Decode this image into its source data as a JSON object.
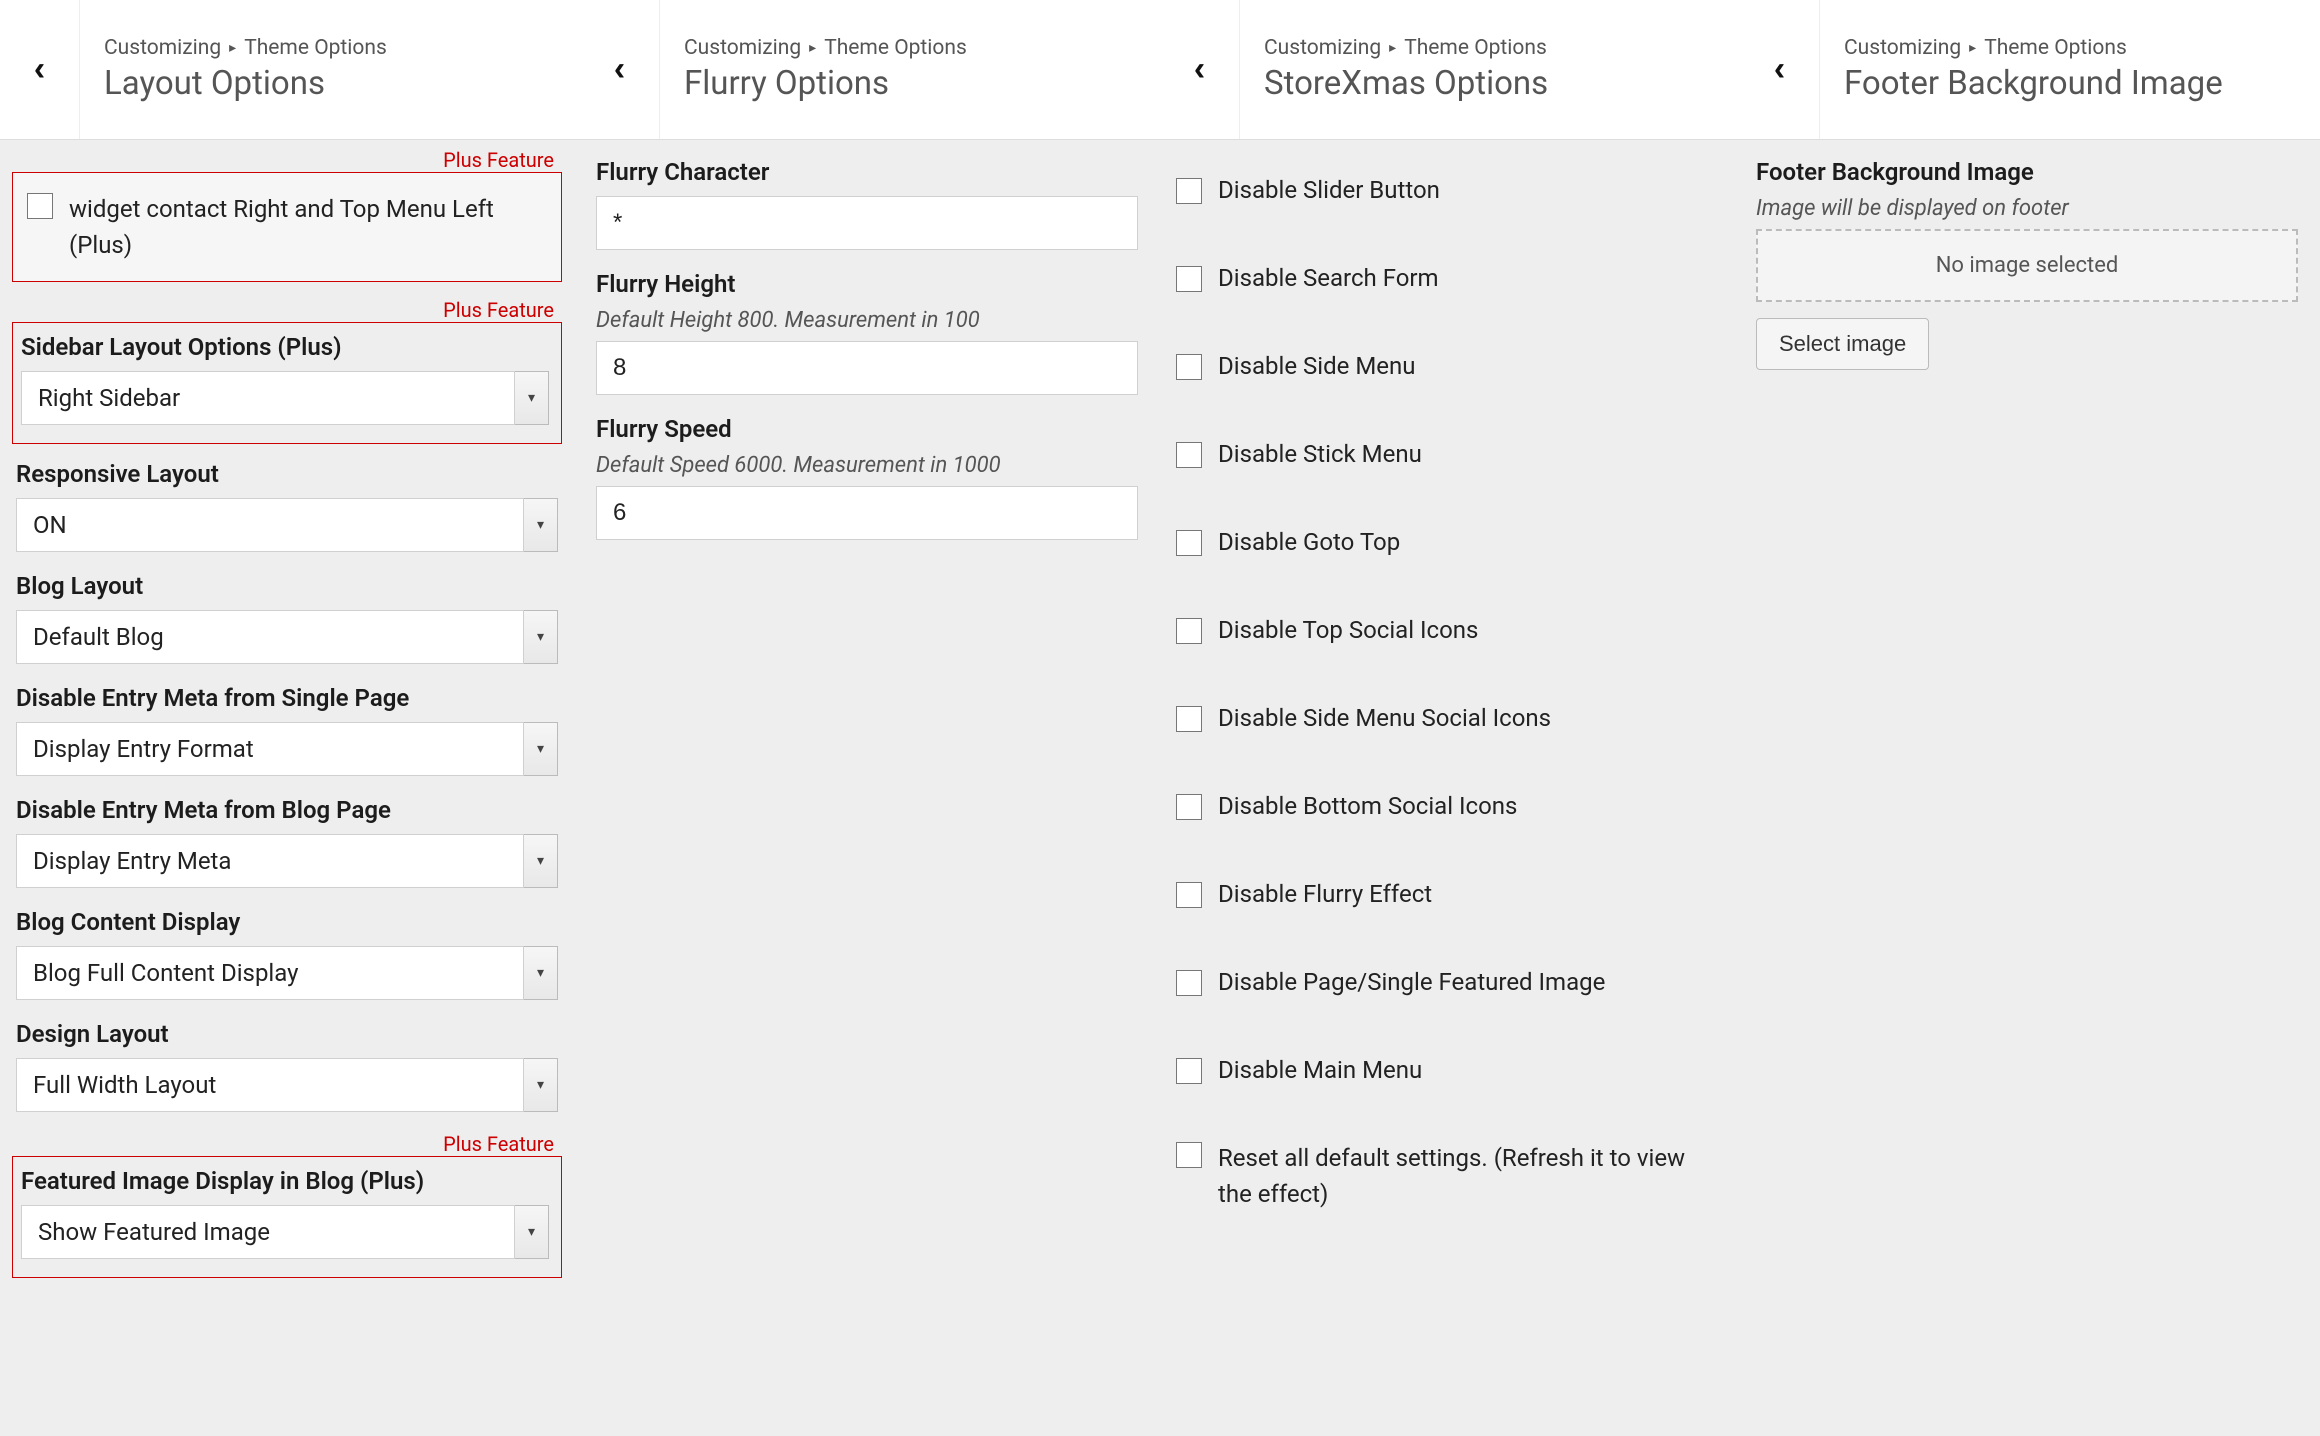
{
  "breadcrumb": {
    "root": "Customizing",
    "sub": "Theme Options"
  },
  "panes": {
    "layout": {
      "title": "Layout Options",
      "plus_text": "Plus Feature",
      "cb_widget_contact": "widget contact Right and Top Menu Left (Plus)",
      "sidebar_layout_label": "Sidebar Layout Options (Plus)",
      "sidebar_layout_value": "Right Sidebar",
      "responsive_label": "Responsive Layout",
      "responsive_value": "ON",
      "blog_layout_label": "Blog Layout",
      "blog_layout_value": "Default Blog",
      "entry_single_label": "Disable Entry Meta from Single Page",
      "entry_single_value": "Display Entry Format",
      "entry_blog_label": "Disable Entry Meta from Blog Page",
      "entry_blog_value": "Display Entry Meta",
      "content_display_label": "Blog Content Display",
      "content_display_value": "Blog Full Content Display",
      "design_layout_label": "Design Layout",
      "design_layout_value": "Full Width Layout",
      "featured_label": "Featured Image Display in Blog (Plus)",
      "featured_value": "Show Featured Image"
    },
    "flurry": {
      "title": "Flurry Options",
      "char_label": "Flurry Character",
      "char_value": "*",
      "height_label": "Flurry Height",
      "height_desc": "Default Height 800. Measurement in 100",
      "height_value": "8",
      "speed_label": "Flurry Speed",
      "speed_desc": "Default Speed 6000. Measurement in 1000",
      "speed_value": "6"
    },
    "storexmas": {
      "title": "StoreXmas Options",
      "cb1": "Disable Slider Button",
      "cb2": "Disable Search Form",
      "cb3": "Disable Side Menu",
      "cb4": "Disable Stick Menu",
      "cb5": "Disable Goto Top",
      "cb6": "Disable Top Social Icons",
      "cb7": "Disable Side Menu Social Icons",
      "cb8": "Disable Bottom Social Icons",
      "cb9": "Disable Flurry Effect",
      "cb10": "Disable Page/Single Featured Image",
      "cb11": "Disable Main Menu",
      "cb12": "Reset all default settings. (Refresh it to view the effect)"
    },
    "footer": {
      "title": "Footer Background Image",
      "section_label": "Footer Background Image",
      "section_desc": "Image will be displayed on footer",
      "placeholder": "No image selected",
      "select_btn": "Select image"
    }
  }
}
